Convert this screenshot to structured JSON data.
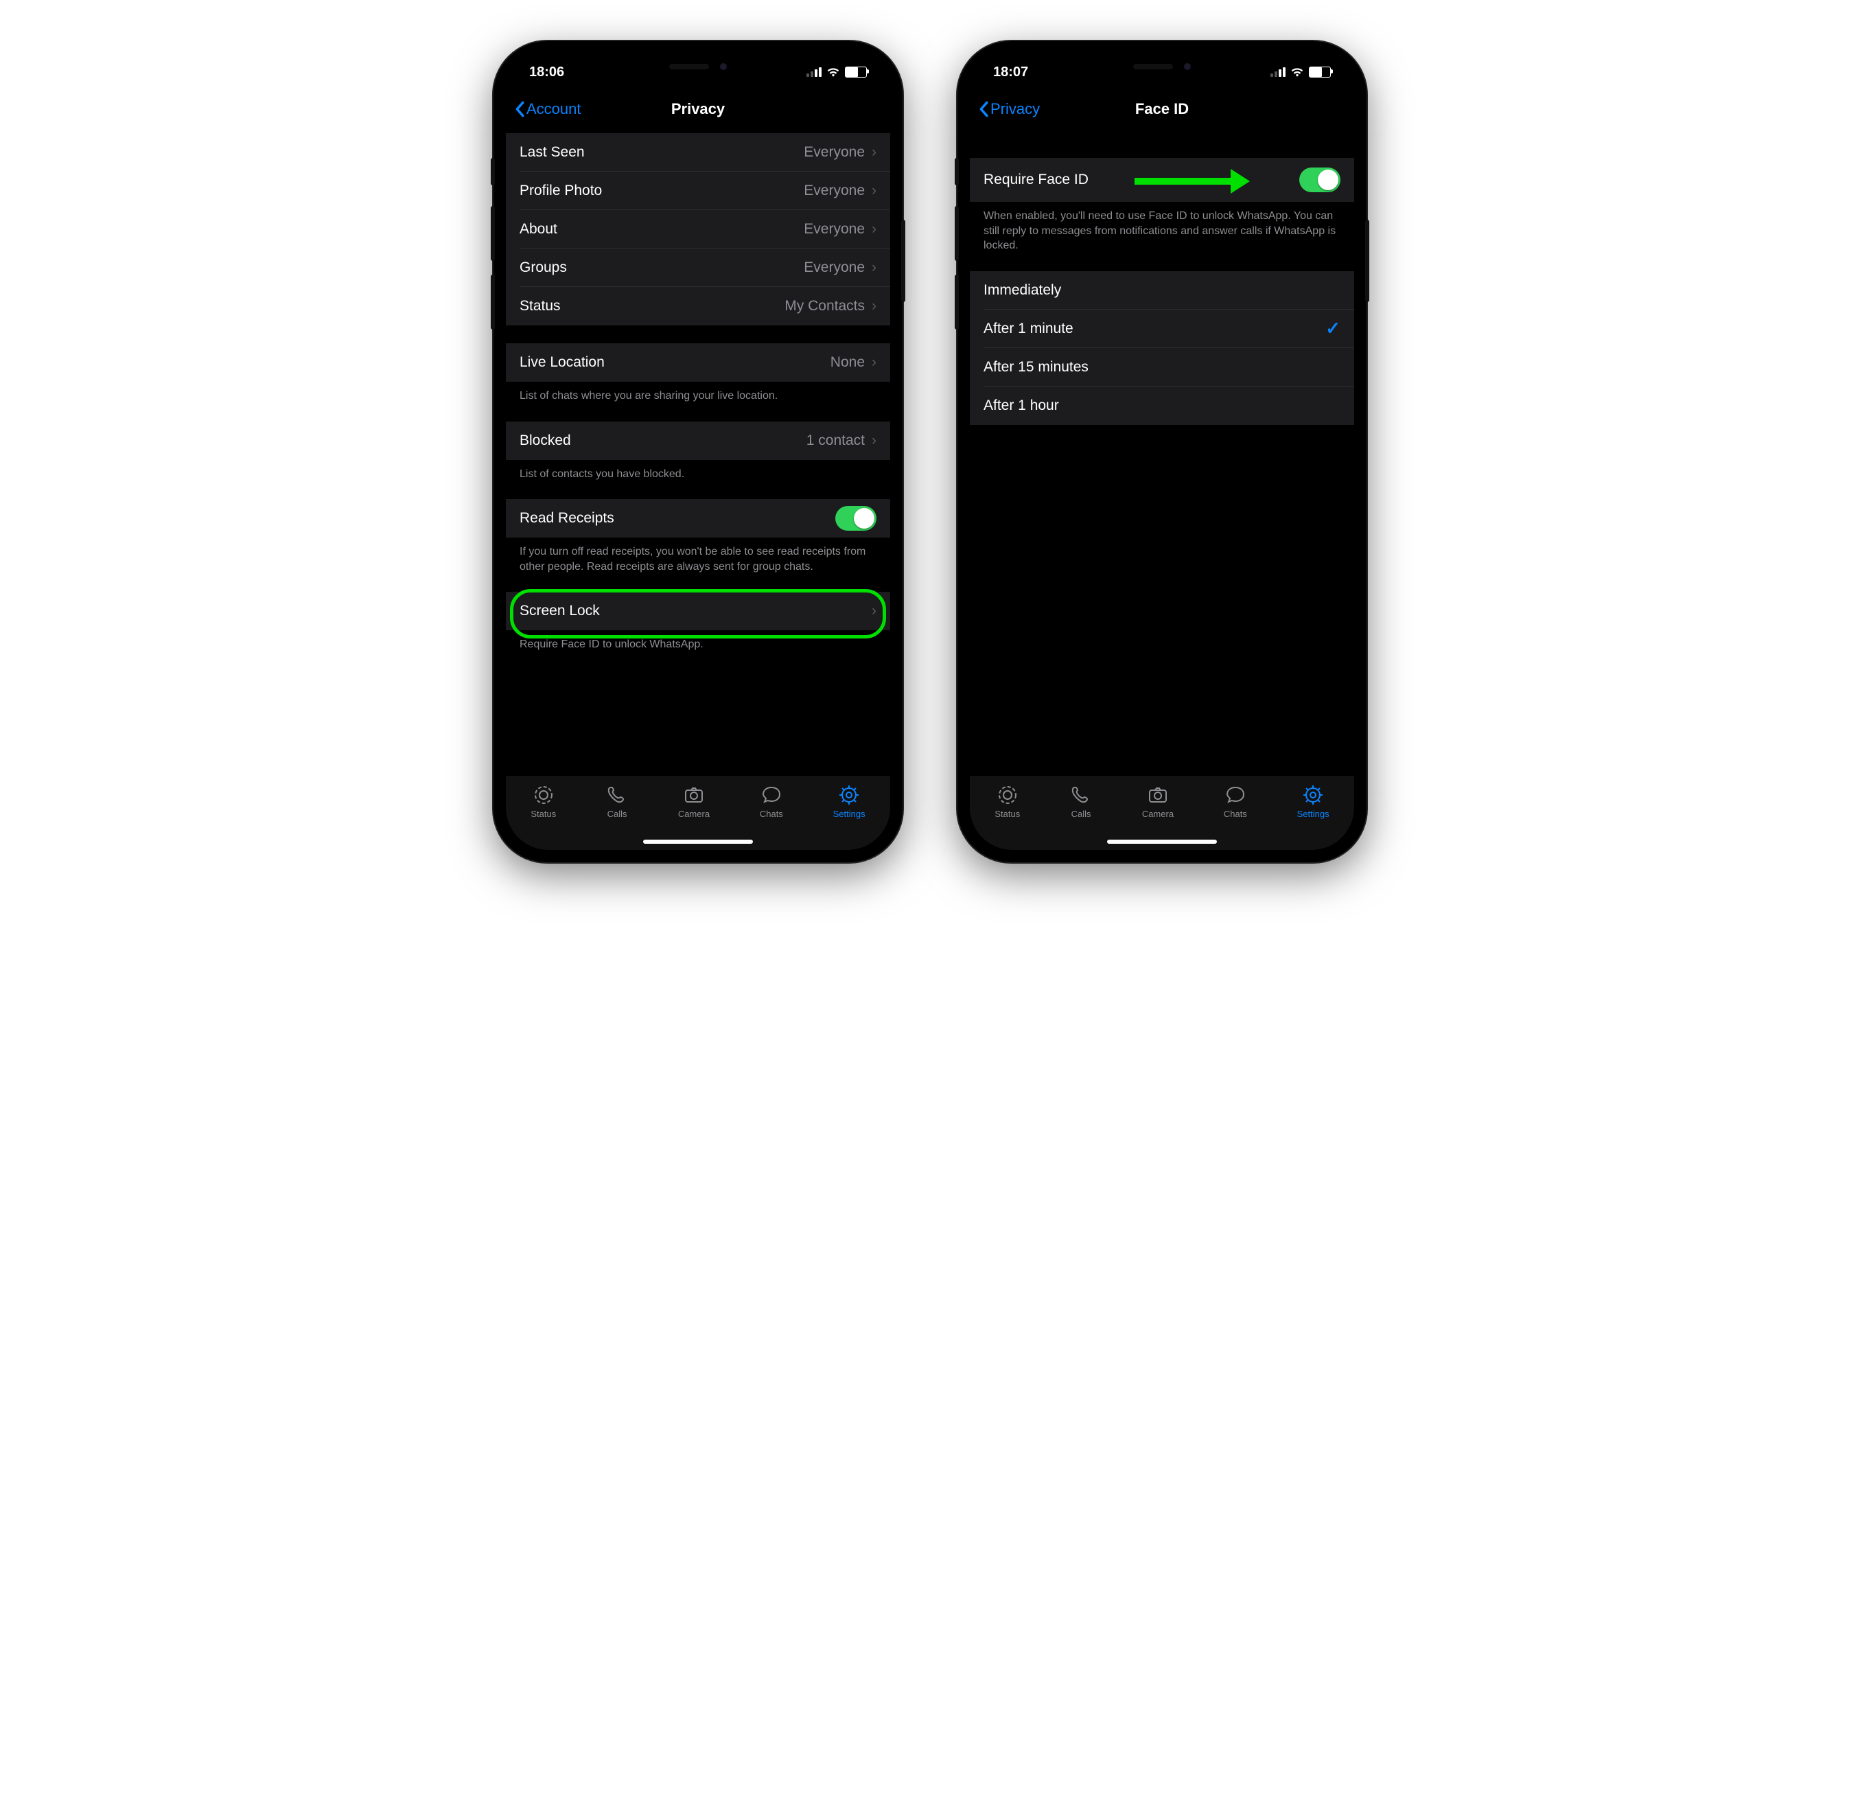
{
  "left": {
    "status": {
      "time": "18:06"
    },
    "nav": {
      "back": "Account",
      "title": "Privacy"
    },
    "section1": [
      {
        "label": "Last Seen",
        "value": "Everyone"
      },
      {
        "label": "Profile Photo",
        "value": "Everyone"
      },
      {
        "label": "About",
        "value": "Everyone"
      },
      {
        "label": "Groups",
        "value": "Everyone"
      },
      {
        "label": "Status",
        "value": "My Contacts"
      }
    ],
    "live_location": {
      "label": "Live Location",
      "value": "None",
      "footer": "List of chats where you are sharing your live location."
    },
    "blocked": {
      "label": "Blocked",
      "value": "1 contact",
      "footer": "List of contacts you have blocked."
    },
    "read_receipts": {
      "label": "Read Receipts",
      "footer": "If you turn off read receipts, you won't be able to see read receipts from other people. Read receipts are always sent for group chats."
    },
    "screen_lock": {
      "label": "Screen Lock",
      "footer": "Require Face ID to unlock WhatsApp."
    },
    "tabs": [
      "Status",
      "Calls",
      "Camera",
      "Chats",
      "Settings"
    ]
  },
  "right": {
    "status": {
      "time": "18:07"
    },
    "nav": {
      "back": "Privacy",
      "title": "Face ID"
    },
    "require": {
      "label": "Require Face ID",
      "footer": "When enabled, you'll need to use Face ID to unlock WhatsApp. You can still reply to messages from notifications and answer calls if WhatsApp is locked."
    },
    "timeouts": [
      "Immediately",
      "After 1 minute",
      "After 15 minutes",
      "After 1 hour"
    ],
    "selected_index": 1,
    "tabs": [
      "Status",
      "Calls",
      "Camera",
      "Chats",
      "Settings"
    ]
  },
  "annotations": {
    "highlight_color": "#00e000"
  }
}
